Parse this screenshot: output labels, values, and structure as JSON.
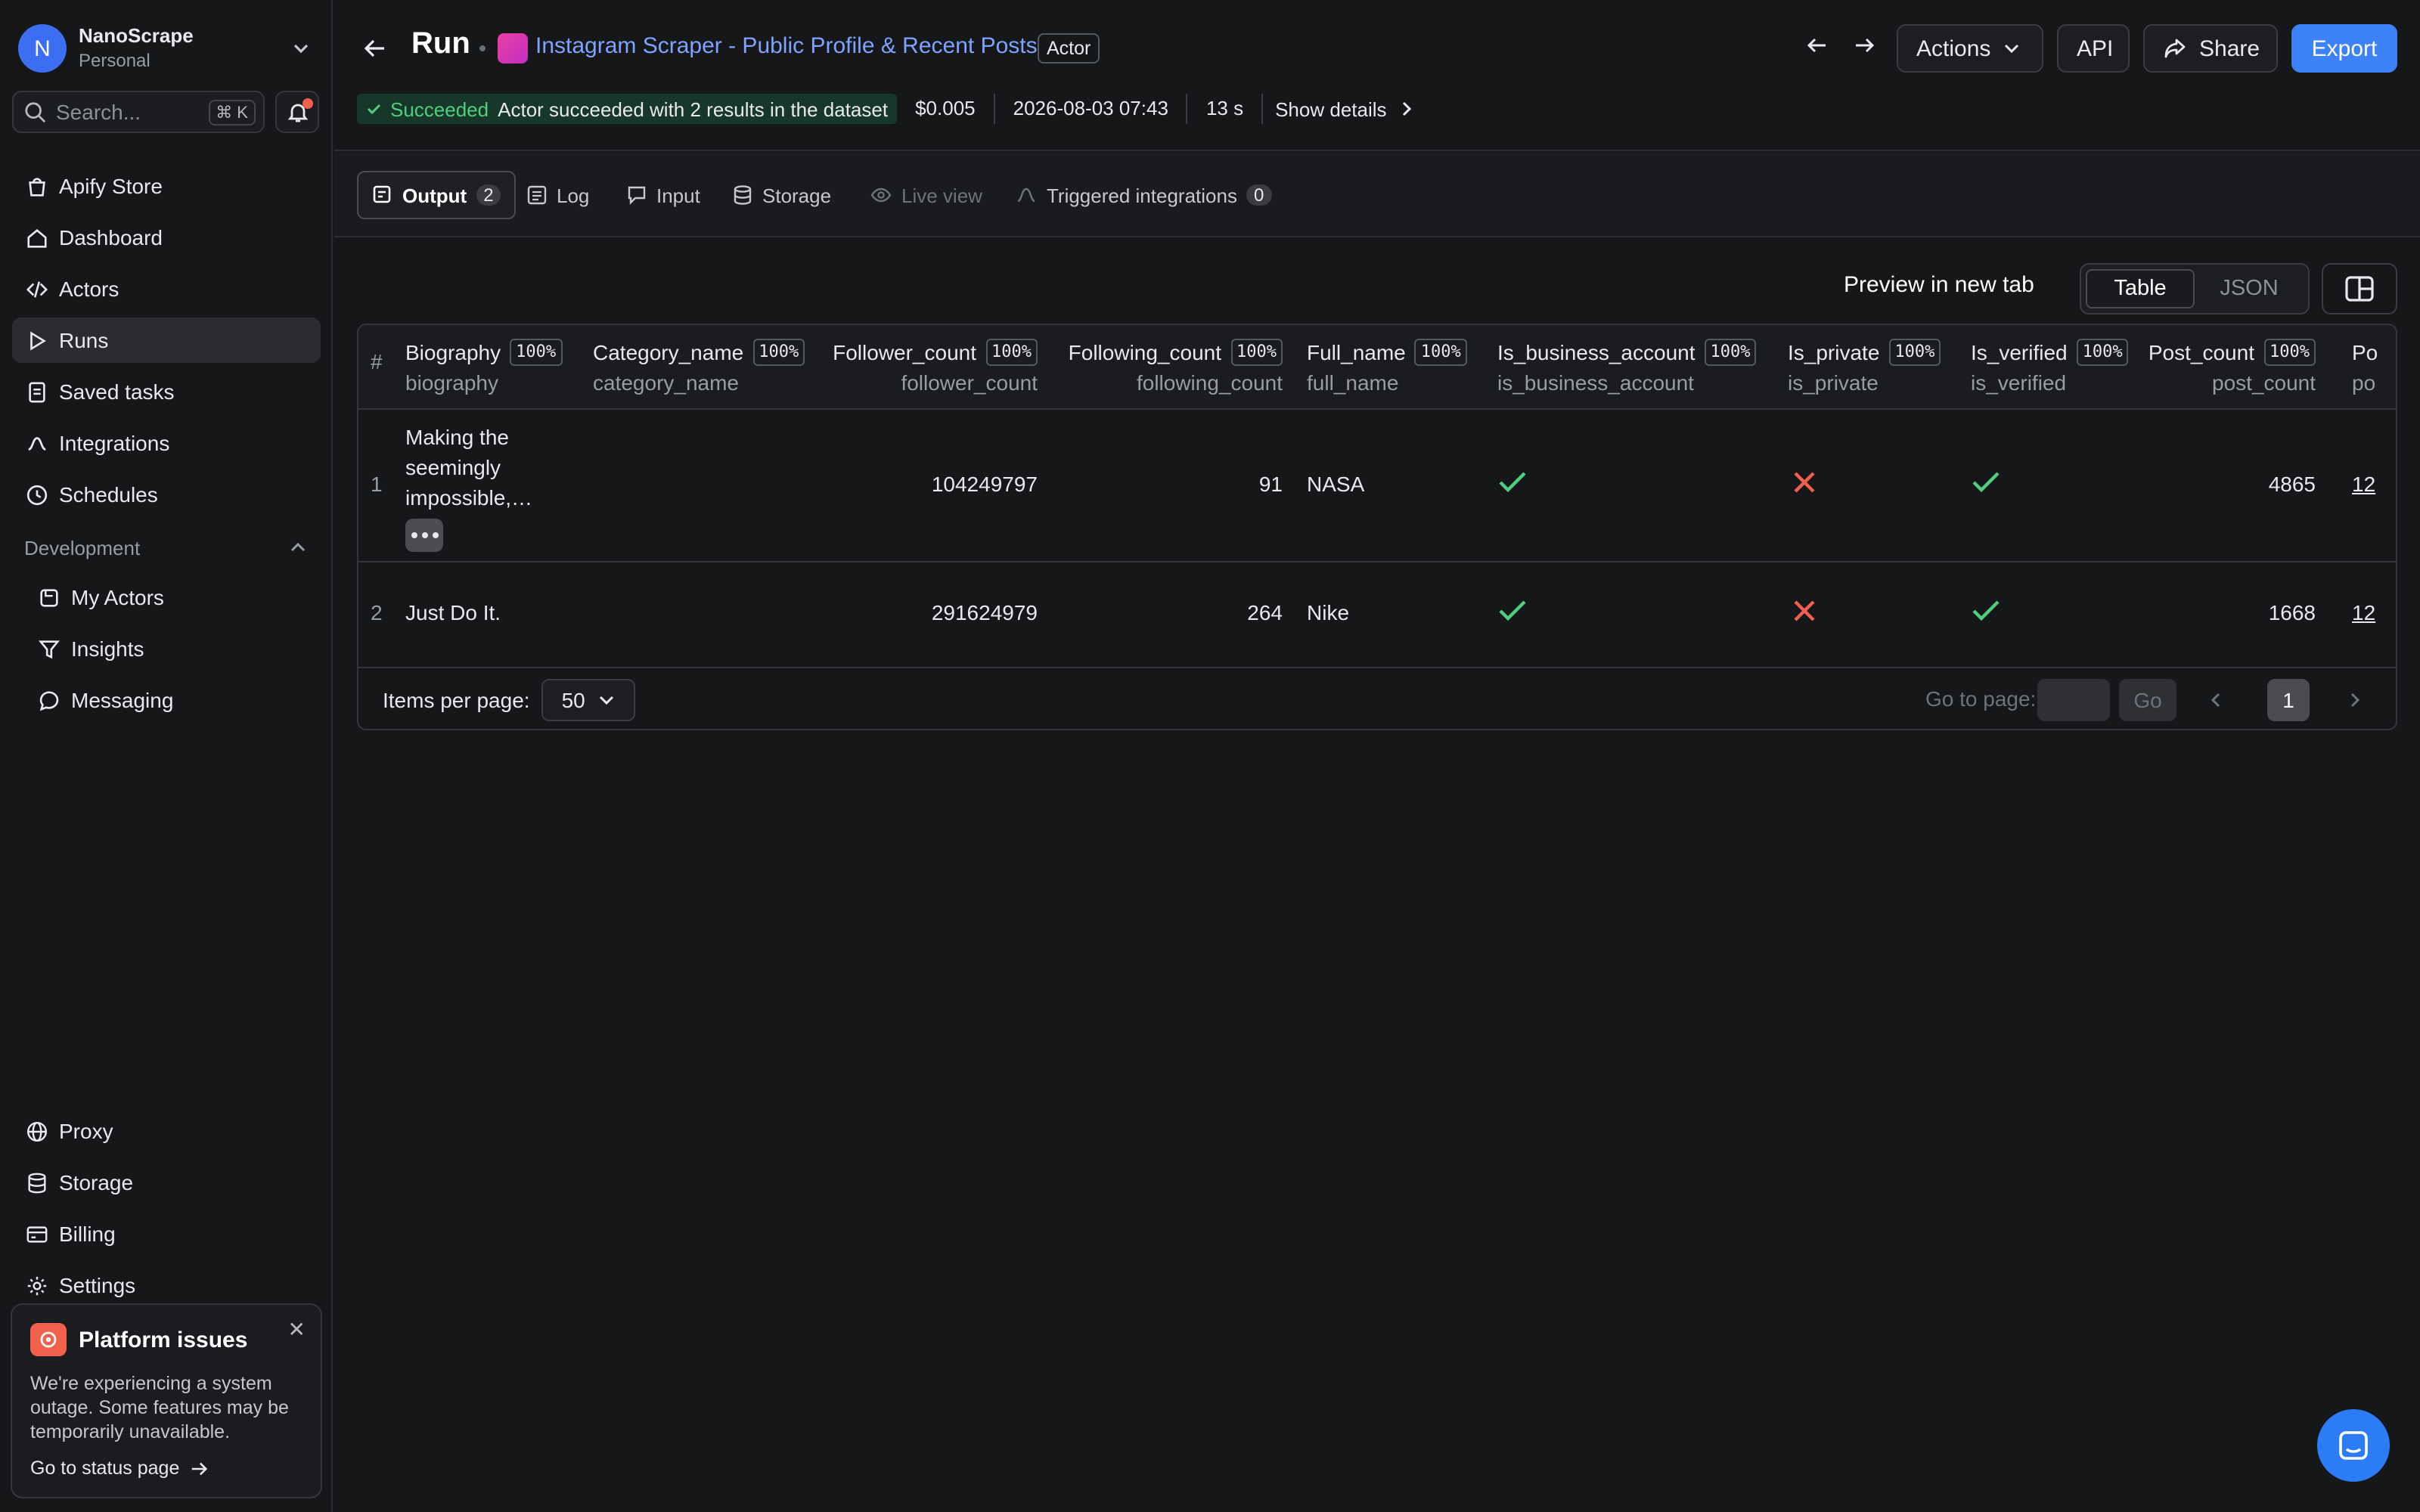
{
  "account": {
    "initial": "N",
    "name": "NanoScrape",
    "plan": "Personal"
  },
  "search": {
    "placeholder": "Search...",
    "shortcut": "⌘ K"
  },
  "sidebar": {
    "items": [
      {
        "label": "Apify Store",
        "icon": "store-icon"
      },
      {
        "label": "Dashboard",
        "icon": "home-icon"
      },
      {
        "label": "Actors",
        "icon": "code-icon"
      },
      {
        "label": "Runs",
        "icon": "play-icon"
      },
      {
        "label": "Saved tasks",
        "icon": "document-icon"
      },
      {
        "label": "Integrations",
        "icon": "integrations-icon"
      },
      {
        "label": "Schedules",
        "icon": "clock-icon"
      }
    ],
    "section_label": "Development",
    "dev_items": [
      {
        "label": "My Actors",
        "icon": "actor-icon"
      },
      {
        "label": "Insights",
        "icon": "funnel-icon"
      },
      {
        "label": "Messaging",
        "icon": "chat-bubble-icon"
      }
    ],
    "bottom_items": [
      {
        "label": "Proxy",
        "icon": "globe-icon"
      },
      {
        "label": "Storage",
        "icon": "database-icon"
      },
      {
        "label": "Billing",
        "icon": "card-icon"
      },
      {
        "label": "Settings",
        "icon": "gear-icon"
      }
    ]
  },
  "toast": {
    "title": "Platform issues",
    "body": "We're experiencing a system outage. Some features may be temporarily unavailable.",
    "link": "Go to status page"
  },
  "header": {
    "title": "Run",
    "actor_name": "Instagram Scraper - Public Profile & Recent Posts",
    "actor_badge": "Actor",
    "actions_label": "Actions",
    "api_label": "API",
    "share_label": "Share",
    "export_label": "Export"
  },
  "status": {
    "state": "Succeeded",
    "message": "Actor succeeded with 2 results in the dataset",
    "cost": "$0.005",
    "started": "2026-08-03 07:43",
    "duration": "13 s",
    "details_label": "Show details"
  },
  "tabs": [
    {
      "label": "Output",
      "count": "2"
    },
    {
      "label": "Log"
    },
    {
      "label": "Input"
    },
    {
      "label": "Storage"
    },
    {
      "label": "Live view"
    },
    {
      "label": "Triggered integrations",
      "count": "0"
    }
  ],
  "view": {
    "preview_label": "Preview in new tab",
    "table_label": "Table",
    "json_label": "JSON",
    "selected": "Table"
  },
  "table": {
    "index_header": "#",
    "columns": [
      {
        "label": "Biography",
        "key": "biography",
        "fill": "100%"
      },
      {
        "label": "Category_name",
        "key": "category_name",
        "fill": "100%"
      },
      {
        "label": "Follower_count",
        "key": "follower_count",
        "fill": "100%"
      },
      {
        "label": "Following_count",
        "key": "following_count",
        "fill": "100%"
      },
      {
        "label": "Full_name",
        "key": "full_name",
        "fill": "100%"
      },
      {
        "label": "Is_business_account",
        "key": "is_business_account",
        "fill": "100%"
      },
      {
        "label": "Is_private",
        "key": "is_private",
        "fill": "100%"
      },
      {
        "label": "Is_verified",
        "key": "is_verified",
        "fill": "100%"
      },
      {
        "label": "Post_count",
        "key": "post_count",
        "fill": "100%"
      },
      {
        "label": "Po",
        "key": "po"
      }
    ],
    "rows": [
      {
        "index": "1",
        "biography": "Making the seemingly impossible,…",
        "category_name": "",
        "follower_count": "104249797",
        "following_count": "91",
        "full_name": "NASA",
        "is_business_account": true,
        "is_private": false,
        "is_verified": true,
        "post_count": "4865",
        "next": "12"
      },
      {
        "index": "2",
        "biography": "Just Do It.",
        "category_name": "",
        "follower_count": "291624979",
        "following_count": "264",
        "full_name": "Nike",
        "is_business_account": true,
        "is_private": false,
        "is_verified": true,
        "post_count": "1668",
        "next": "12"
      }
    ],
    "items_per_page_label": "Items per page:",
    "items_per_page": "50",
    "goto_label": "Go to page:",
    "go_label": "Go",
    "current_page": "1"
  },
  "colors": {
    "accent": "#3d82f6",
    "link": "#7ea3ff",
    "success": "#4fcf7d",
    "error": "#f0604a",
    "background": "#161719"
  }
}
